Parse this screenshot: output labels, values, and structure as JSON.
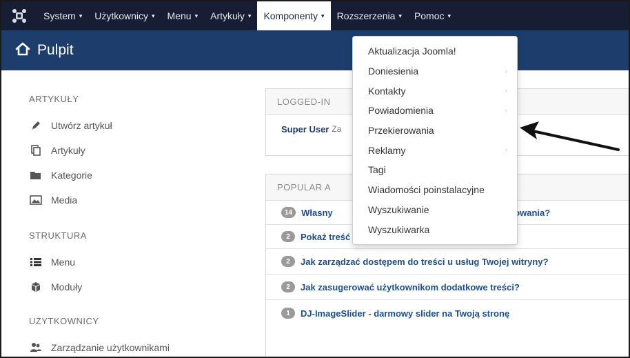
{
  "navbar": {
    "logo_icon": "joomla-logo-icon",
    "items": [
      {
        "label": "System",
        "has_caret": true
      },
      {
        "label": "Użytkownicy",
        "has_caret": true
      },
      {
        "label": "Menu",
        "has_caret": true
      },
      {
        "label": "Artykuły",
        "has_caret": true
      },
      {
        "label": "Komponenty",
        "has_caret": true,
        "active": true
      },
      {
        "label": "Rozszerzenia",
        "has_caret": true
      },
      {
        "label": "Pomoc",
        "has_caret": true
      }
    ],
    "caret": "▾"
  },
  "subhead": {
    "icon": "home-icon",
    "title": "Pulpit"
  },
  "sidebar": {
    "sections": [
      {
        "heading": "ARTYKUŁY",
        "items": [
          {
            "label": "Utwórz artykuł",
            "icon": "pencil-icon"
          },
          {
            "label": "Artykuły",
            "icon": "copy-icon"
          },
          {
            "label": "Kategorie",
            "icon": "folder-icon"
          },
          {
            "label": "Media",
            "icon": "image-icon"
          }
        ]
      },
      {
        "heading": "STRUKTURA",
        "items": [
          {
            "label": "Menu",
            "icon": "list-icon"
          },
          {
            "label": "Moduły",
            "icon": "cube-icon"
          }
        ]
      },
      {
        "heading": "UŻYTKOWNICY",
        "items": [
          {
            "label": "Zarządzanie użytkownikami",
            "icon": "users-icon"
          }
        ]
      }
    ]
  },
  "logged_in": {
    "heading": "LOGGED-IN",
    "user": "Super User",
    "suffix": "Za"
  },
  "popular": {
    "heading": "POPULAR A",
    "rows": [
      {
        "count": "14",
        "title": "Własny",
        "tail": "mowania?"
      },
      {
        "count": "2",
        "title": "Pokaż treść w atrakcyjnym wydaniu"
      },
      {
        "count": "2",
        "title": "Jak zarządzać dostępem do treści u usług Twojej witryny?"
      },
      {
        "count": "2",
        "title": "Jak zasugerować użytkownikom dodatkowe treści?"
      },
      {
        "count": "1",
        "title": "DJ-ImageSlider - darmowy slider na Twoją stronę"
      }
    ]
  },
  "dropdown": {
    "items": [
      {
        "label": "Aktualizacja Joomla!",
        "submenu": false
      },
      {
        "label": "Doniesienia",
        "submenu": true
      },
      {
        "label": "Kontakty",
        "submenu": true
      },
      {
        "label": "Powiadomienia",
        "submenu": true
      },
      {
        "label": "Przekierowania",
        "submenu": false
      },
      {
        "label": "Reklamy",
        "submenu": true
      },
      {
        "label": "Tagi",
        "submenu": false
      },
      {
        "label": "Wiadomości poinstalacyjne",
        "submenu": false
      },
      {
        "label": "Wyszukiwanie",
        "submenu": false
      },
      {
        "label": "Wyszukiwarka",
        "submenu": false
      }
    ],
    "submenu_arrow": "›"
  },
  "colors": {
    "navbar_bg": "#171d33",
    "subhead_bg": "#1d3e6d",
    "link": "#1d4f8b",
    "badge": "#9a9a9a"
  }
}
